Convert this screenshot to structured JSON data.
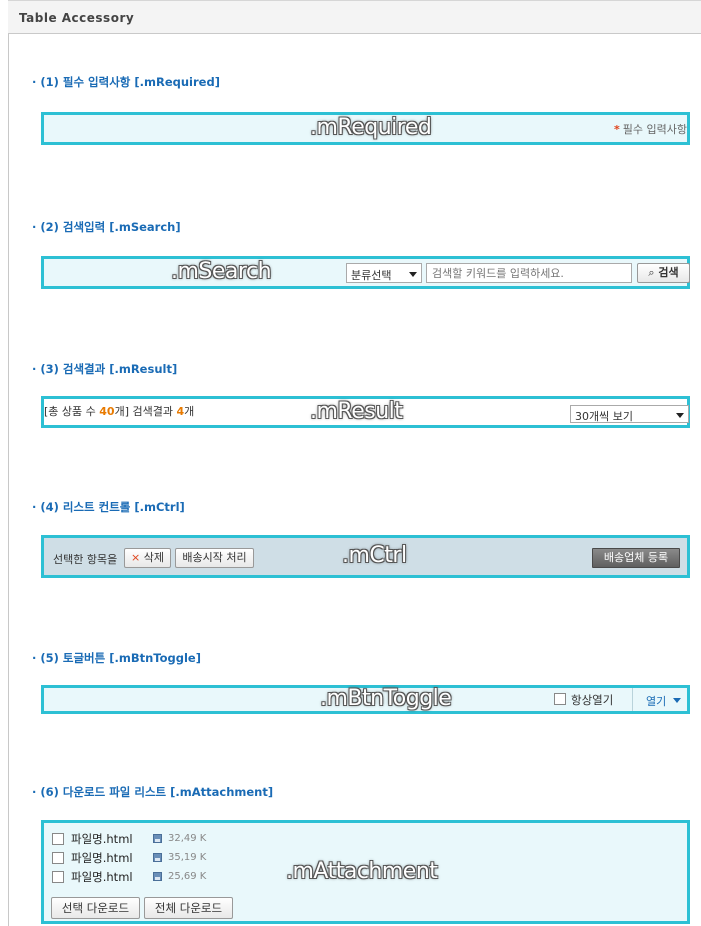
{
  "header": {
    "title": "Table Accessory"
  },
  "sections": [
    {
      "title": "(1) 필수 입력사항 [.mRequired]",
      "label": ".mRequired"
    },
    {
      "title": "(2) 검색입력 [.mSearch]",
      "label": ".mSearch"
    },
    {
      "title": "(3) 검색결과 [.mResult]",
      "label": ".mResult"
    },
    {
      "title": "(4) 리스트 컨트롤 [.mCtrl]",
      "label": ".mCtrl"
    },
    {
      "title": "(5) 토글버튼 [.mBtnToggle]",
      "label": ".mBtnToggle"
    },
    {
      "title": "(6) 다운로드 파일 리스트 [.mAttachment]",
      "label": ".mAttachment"
    }
  ],
  "required": {
    "star": "*",
    "text": "필수 입력사항"
  },
  "search": {
    "category_selected": "분류선택",
    "placeholder": "검색할 키워드를 입력하세요.",
    "button_label": "검색"
  },
  "result": {
    "prefix": "[총 상품 수 ",
    "total": "40",
    "mid": "개] 검색결과 ",
    "found": "4",
    "suffix": "개",
    "per_page_selected": "30개씩 보기"
  },
  "ctrl": {
    "label": "선택한 항목을",
    "delete_label": "삭제",
    "ship_start_label": "배송시작 처리",
    "register_carrier_label": "배송업체 등록"
  },
  "toggle": {
    "always_open_label": "항상열기",
    "open_label": "열기"
  },
  "attachment": {
    "files": [
      {
        "name": "파일명.html",
        "size": "32,49 K"
      },
      {
        "name": "파일명.html",
        "size": "35,19 K"
      },
      {
        "name": "파일명.html",
        "size": "25,69 K"
      }
    ],
    "download_selected_label": "선택 다운로드",
    "download_all_label": "전체 다운로드"
  },
  "colors": {
    "accent": "#2dc0d4",
    "title": "#1a6bb5",
    "highlight": "#e87a00",
    "required_star": "#e0421a"
  }
}
